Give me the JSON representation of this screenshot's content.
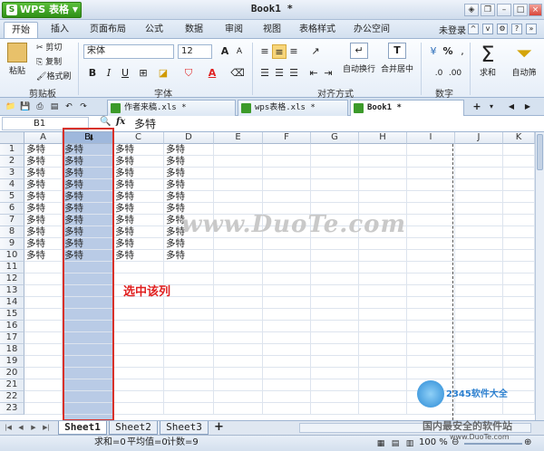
{
  "app": {
    "name": "WPS 表格",
    "doc_title": "Book1 *"
  },
  "menu": {
    "tabs": [
      "开始",
      "插入",
      "页面布局",
      "公式",
      "数据",
      "审阅",
      "视图",
      "表格样式",
      "办公空间"
    ],
    "active": "开始",
    "login": "未登录"
  },
  "ribbon": {
    "clipboard": {
      "paste": "粘贴",
      "cut": "剪切",
      "copy": "复制",
      "format_painter": "格式刷",
      "label": "剪贴板"
    },
    "font": {
      "name": "宋体",
      "size": "12",
      "label": "字体",
      "bold": "B",
      "italic": "I",
      "underline": "U"
    },
    "align": {
      "wrap": "自动换行",
      "merge": "合并居中",
      "label": "对齐方式"
    },
    "number": {
      "percent": "%",
      "label": "数字"
    },
    "sum": {
      "label": "求和"
    },
    "filter": {
      "label": "自动筛"
    }
  },
  "doc_tabs": [
    {
      "label": "作者来稿.xls *",
      "active": false
    },
    {
      "label": "wps表格.xls *",
      "active": false
    },
    {
      "label": "Book1 *",
      "active": true
    }
  ],
  "formula": {
    "cell_ref": "B1",
    "fx": "fx",
    "value": "多特"
  },
  "grid": {
    "columns": [
      "A",
      "B",
      "C",
      "D",
      "E",
      "F",
      "G",
      "H",
      "I",
      "J",
      "K"
    ],
    "rows": [
      "1",
      "2",
      "3",
      "4",
      "5",
      "6",
      "7",
      "8",
      "9",
      "10",
      "11",
      "12",
      "13",
      "14",
      "15",
      "16",
      "17",
      "18",
      "19",
      "20",
      "21",
      "22",
      "23"
    ],
    "filled_text": "多特",
    "filled_rows": 10,
    "filled_cols": [
      "A",
      "B",
      "C",
      "D"
    ],
    "selected_column": "B"
  },
  "annotation": {
    "text": "选中该列",
    "color": "#e02020"
  },
  "watermark": {
    "text": "www.DuoTe.com"
  },
  "brand": {
    "site": "2345软件大全",
    "slogan": "国内最安全的软件站",
    "url": "www.DuoTe.com"
  },
  "sheets": {
    "tabs": [
      "Sheet1",
      "Sheet2",
      "Sheet3"
    ],
    "active": "Sheet1",
    "add": "+"
  },
  "status": {
    "sum": "求和=0",
    "avg": "平均值=0",
    "count": "计数=9",
    "zoom": "100 %"
  },
  "colors": {
    "accent_green": "#3c9a2a",
    "selection": "#b9cbe6",
    "highlight_border": "#d8312a"
  }
}
